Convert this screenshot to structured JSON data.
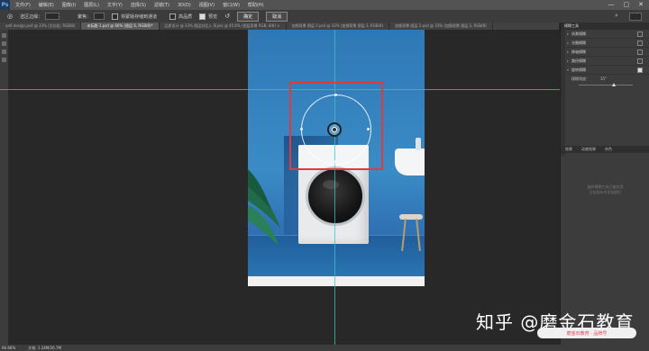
{
  "menubar": {
    "logo": "Ps",
    "items": [
      "文件(F)",
      "编辑(E)",
      "图像(I)",
      "图层(L)",
      "文字(Y)",
      "选择(S)",
      "滤镜(T)",
      "3D(D)",
      "视图(V)",
      "窗口(W)",
      "帮助(H)"
    ],
    "window_controls": [
      "—",
      "▢",
      "✕"
    ]
  },
  "options": {
    "selection_label": "选区边缘：",
    "focus_label": "聚焦：",
    "save_mask_label": "将蒙版存储到通道",
    "highquality_label": "高品质",
    "preview_label": "预览",
    "confirm_button": "确定",
    "cancel_button": "取消"
  },
  "tabs": [
    "an6 design.psd @ 33% (文化组, RGB/8)",
    "未标题-1.psd @ 66% (图层 6, RGB/8)*",
    "品质设计 @ 33% 图层对比入 (Eyes @ 45.6% (图层背景 RGB, 8/8) ×",
    "加细背景 图层 2.psd @ 33% (加细背景 图层 2, RGB/8)",
    "加细背景 图层 2.psd @ 33% (加细背景 图层 2, RGB/8)"
  ],
  "panel": {
    "header": "模糊工具",
    "filters": [
      {
        "label": "场景模糊",
        "checked": false
      },
      {
        "label": "光圈模糊",
        "checked": false
      },
      {
        "label": "移轴模糊",
        "checked": false
      },
      {
        "label": "路径模糊",
        "checked": false
      },
      {
        "label": "旋转模糊",
        "checked": true
      }
    ],
    "amount_label": "模糊角度：",
    "amount_value": "35°",
    "tabs2": [
      "效果",
      "动感效果",
      "杂色"
    ],
    "message": "旋转模糊工具已被启用\n已在画布中添加图钉"
  },
  "status": {
    "zoom": "66.66%",
    "doc": "文档: 1.24M/26.7M"
  },
  "watermark": {
    "text": "知乎 @磨金石教育",
    "badge": "磨金石教育 · 品牌号"
  },
  "colors": {
    "guide": "#3fc1c9",
    "selection": "#e23a3a",
    "canvas_blue": "#2f78b6"
  }
}
